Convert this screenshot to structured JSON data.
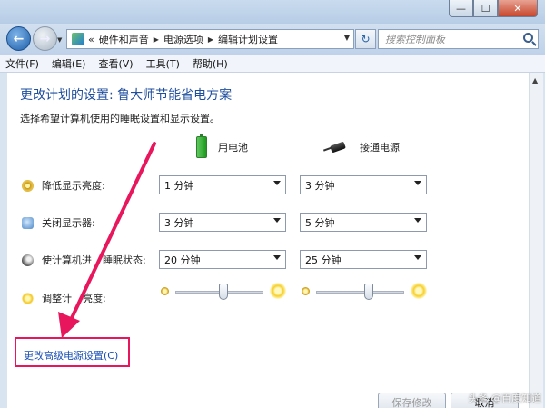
{
  "window": {
    "min_glyph": "—",
    "max_glyph": "☐",
    "close_glyph": "✕"
  },
  "nav": {
    "back_glyph": "←",
    "fwd_glyph": "→",
    "dropdown_glyph": "▼",
    "crumb_sep": "«",
    "breadcrumbs": [
      "硬件和声音",
      "电源选项",
      "编辑计划设置"
    ],
    "refresh_glyph": "↻",
    "search_placeholder": "搜索控制面板"
  },
  "menu": [
    "文件(F)",
    "编辑(E)",
    "查看(V)",
    "工具(T)",
    "帮助(H)"
  ],
  "page": {
    "title": "更改计划的设置: 鲁大师节能省电方案",
    "subtitle": "选择希望计算机使用的睡眠设置和显示设置。"
  },
  "columns": {
    "battery": "用电池",
    "plugged_in": "接通电源"
  },
  "rows": {
    "dim": {
      "label": "降低显示亮度:",
      "battery": "1 分钟",
      "plugged": "3 分钟"
    },
    "display_off": {
      "label": "关闭显示器:",
      "battery": "3 分钟",
      "plugged": "5 分钟"
    },
    "sleep": {
      "label_pre": "使计算机进",
      "label_post": "睡眠状态:",
      "battery": "20 分钟",
      "plugged": "25 分钟"
    },
    "brightness": {
      "label_pre": "调整计",
      "label_post": "亮度:",
      "battery_level": 0.55,
      "plugged_level": 0.6
    }
  },
  "advanced_link": "更改高级电源设置(C)",
  "buttons": {
    "save": "保存修改",
    "cancel": "取消"
  },
  "watermark": "头条 @百度知道",
  "colors": {
    "highlight": "#e8175d",
    "link": "#1a4fb4",
    "title": "#1f4e9c"
  }
}
